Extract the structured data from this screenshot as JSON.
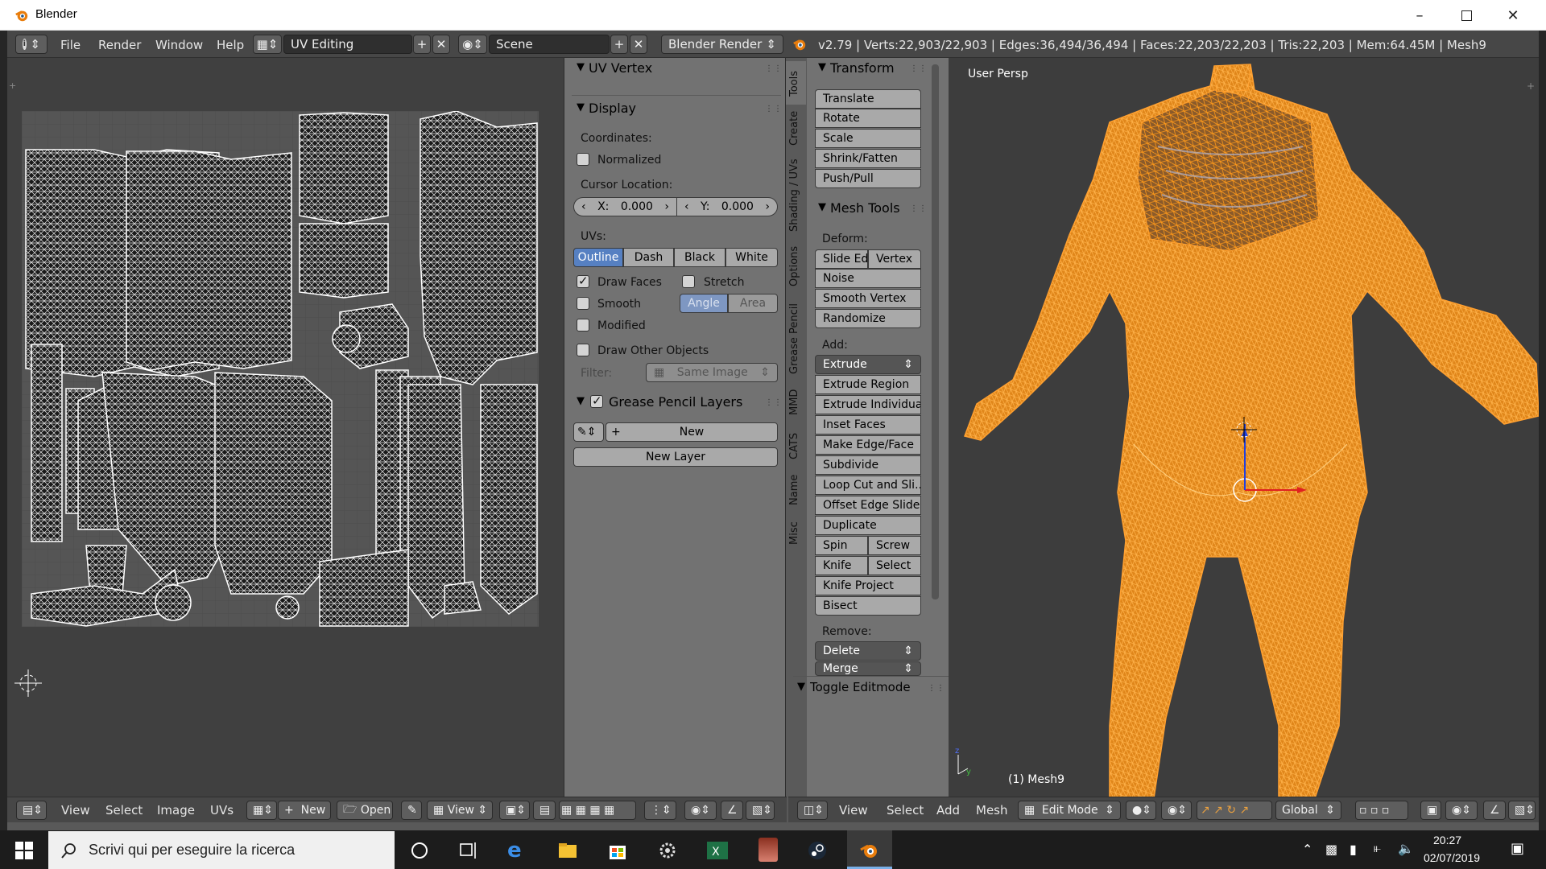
{
  "window": {
    "title": "Blender",
    "minimize_icon": "minimize-icon",
    "maximize_icon": "maximize-icon",
    "close_icon": "close-icon"
  },
  "header": {
    "menus": [
      "File",
      "Render",
      "Window",
      "Help"
    ],
    "screen_layout": "UV Editing",
    "scene": "Scene",
    "render_engine": "Blender Render",
    "stats": "v2.79 | Verts:22,903/22,903 | Edges:36,494/36,494 | Faces:22,203/22,203 | Tris:22,203 | Mem:64.45M | Mesh9"
  },
  "npanel": {
    "uv_vertex_title": "UV Vertex",
    "display_title": "Display",
    "coordinates_label": "Coordinates:",
    "normalized_label": "Normalized",
    "normalized_checked": false,
    "cursor_location_label": "Cursor Location:",
    "cursor_x_label": "X:",
    "cursor_x_value": "0.000",
    "cursor_y_label": "Y:",
    "cursor_y_value": "0.000",
    "uvs_label": "UVs:",
    "uv_modes": [
      "Outline",
      "Dash",
      "Black",
      "White"
    ],
    "uv_mode_selected": "Outline",
    "draw_faces_label": "Draw Faces",
    "draw_faces_checked": true,
    "stretch_label": "Stretch",
    "stretch_checked": false,
    "smooth_label": "Smooth",
    "smooth_checked": false,
    "angle_label": "Angle",
    "area_label": "Area",
    "modified_label": "Modified",
    "modified_checked": false,
    "draw_other_label": "Draw Other Objects",
    "draw_other_checked": false,
    "filter_label": "Filter:",
    "filter_value": "Same Image",
    "grease_title": "Grease Pencil Layers",
    "new_label": "New",
    "new_layer_label": "New Layer"
  },
  "tool_tabs": [
    "Tools",
    "Create",
    "Shading / UVs",
    "Options",
    "Grease Pencil",
    "MMD",
    "CATS",
    "Name",
    "Misc"
  ],
  "toolshelf": {
    "transform_title": "Transform",
    "transform_buttons": [
      "Translate",
      "Rotate",
      "Scale",
      "Shrink/Fatten",
      "Push/Pull"
    ],
    "mesh_tools_title": "Mesh Tools",
    "deform_label": "Deform:",
    "slide_edge": "Slide Ed",
    "vertex": "Vertex",
    "noise": "Noise",
    "smooth_vertex": "Smooth Vertex",
    "randomize": "Randomize",
    "add_label": "Add:",
    "extrude": "Extrude",
    "extrude_region": "Extrude Region",
    "extrude_individual": "Extrude Individual",
    "inset_faces": "Inset Faces",
    "make_edge_face": "Make Edge/Face",
    "subdivide": "Subdivide",
    "loop_cut": "Loop Cut and Sli...",
    "offset_edge_slide": "Offset Edge Slide",
    "duplicate": "Duplicate",
    "spin": "Spin",
    "screw": "Screw",
    "knife": "Knife",
    "select": "Select",
    "knife_project": "Knife Project",
    "bisect": "Bisect",
    "remove_label": "Remove:",
    "delete": "Delete",
    "merge": "Merge",
    "toggle_editmode": "Toggle Editmode"
  },
  "viewport": {
    "view_name": "User Persp",
    "object_label": "(1) Mesh9"
  },
  "uv_header": {
    "menus": [
      "View",
      "Select",
      "Image",
      "UVs"
    ],
    "new_label": "New",
    "open_label": "Open",
    "view_label": "View"
  },
  "view3d_header": {
    "menus": [
      "View",
      "Select",
      "Add",
      "Mesh"
    ],
    "mode": "Edit Mode",
    "orientation": "Global"
  },
  "taskbar": {
    "search_placeholder": "Scrivi qui per eseguire la ricerca",
    "time": "20:27",
    "date": "02/07/2019"
  },
  "colors": {
    "selected_mesh": "#ff9a1a",
    "panel_bg": "#727272",
    "selected_button": "#5680c2",
    "header_bg": "#474747"
  }
}
